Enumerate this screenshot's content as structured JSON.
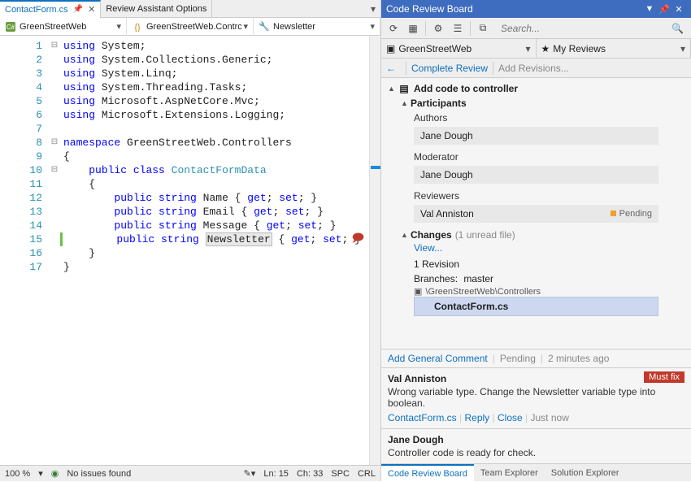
{
  "tabs": {
    "active": "ContactForm.cs",
    "other": "Review Assistant Options"
  },
  "breadcrumb": {
    "project": "GreenStreetWeb",
    "namespace": "GreenStreetWeb.Contrc",
    "member": "Newsletter"
  },
  "code": {
    "lines": [
      {
        "n": 1,
        "fold": "⊟",
        "html": "<span class='kw'>using</span> System;"
      },
      {
        "n": 2,
        "fold": "",
        "html": "<span class='kw'>using</span> System.Collections.Generic;"
      },
      {
        "n": 3,
        "fold": "",
        "html": "<span class='kw'>using</span> System.Linq;"
      },
      {
        "n": 4,
        "fold": "",
        "html": "<span class='kw'>using</span> System.Threading.Tasks;"
      },
      {
        "n": 5,
        "fold": "",
        "html": "<span class='kw'>using</span> Microsoft.AspNetCore.Mvc;"
      },
      {
        "n": 6,
        "fold": "",
        "html": "<span class='kw'>using</span> Microsoft.Extensions.Logging;"
      },
      {
        "n": 7,
        "fold": "",
        "html": ""
      },
      {
        "n": 8,
        "fold": "⊟",
        "html": "<span class='kw'>namespace</span> GreenStreetWeb.Controllers"
      },
      {
        "n": 9,
        "fold": "",
        "html": "{"
      },
      {
        "n": 10,
        "fold": "⊟",
        "html": "    <span class='kw'>public</span> <span class='kw'>class</span> <span class='type'>ContactFormData</span>"
      },
      {
        "n": 11,
        "fold": "",
        "html": "    {"
      },
      {
        "n": 12,
        "fold": "",
        "html": "        <span class='kw'>public</span> <span class='kw'>string</span> Name { <span class='kw'>get</span>; <span class='kw'>set</span>; }"
      },
      {
        "n": 13,
        "fold": "",
        "html": "        <span class='kw'>public</span> <span class='kw'>string</span> Email { <span class='kw'>get</span>; <span class='kw'>set</span>; }"
      },
      {
        "n": 14,
        "fold": "",
        "html": "        <span class='kw'>public</span> <span class='kw'>string</span> Message { <span class='kw'>get</span>; <span class='kw'>set</span>; }"
      },
      {
        "n": 15,
        "fold": "",
        "html": "        <span class='kw'>public</span> <span class='kw'>string</span> <span class='hl'>Newsletter</span> { <span class='kw'>get</span>; <span class='kw'>set</span>; }",
        "green": true,
        "pencil": true,
        "comment": true
      },
      {
        "n": 16,
        "fold": "",
        "html": "    }"
      },
      {
        "n": 17,
        "fold": "",
        "html": "}"
      }
    ]
  },
  "status": {
    "zoom": "100 %",
    "issues": "No issues found",
    "ln": "Ln: 15",
    "ch": "Ch: 33",
    "spc": "SPC",
    "crlf": "CRL"
  },
  "panel": {
    "title": "Code Review Board",
    "search_placeholder": "Search...",
    "project": "GreenStreetWeb",
    "filter": "My Reviews",
    "complete": "Complete Review",
    "add_revisions": "Add Revisions...",
    "task": "Add code to controller",
    "participants_label": "Participants",
    "authors_label": "Authors",
    "author": "Jane Dough",
    "moderator_label": "Moderator",
    "moderator": "Jane Dough",
    "reviewers_label": "Reviewers",
    "reviewer": "Val Anniston",
    "reviewer_status": "Pending",
    "changes_label": "Changes",
    "changes_hint": "(1 unread file)",
    "view": "View...",
    "revision": "1 Revision",
    "branches_label": "Branches:",
    "branch": "master",
    "folder": "\\GreenStreetWeb\\Controllers",
    "file": "ContactForm.cs",
    "add_comment": "Add General Comment",
    "pending": "Pending",
    "time": "2 minutes ago"
  },
  "comments": [
    {
      "author": "Val Anniston",
      "badge": "Must fix",
      "text": "Wrong variable type. Change the Newsletter variable type into boolean.",
      "file": "ContactForm.cs",
      "actions": [
        "Reply",
        "Close"
      ],
      "time": "Just now"
    },
    {
      "author": "Jane Dough",
      "text": "Controller code is ready for check."
    }
  ],
  "bottom_tabs": [
    "Code Review Board",
    "Team Explorer",
    "Solution Explorer"
  ]
}
